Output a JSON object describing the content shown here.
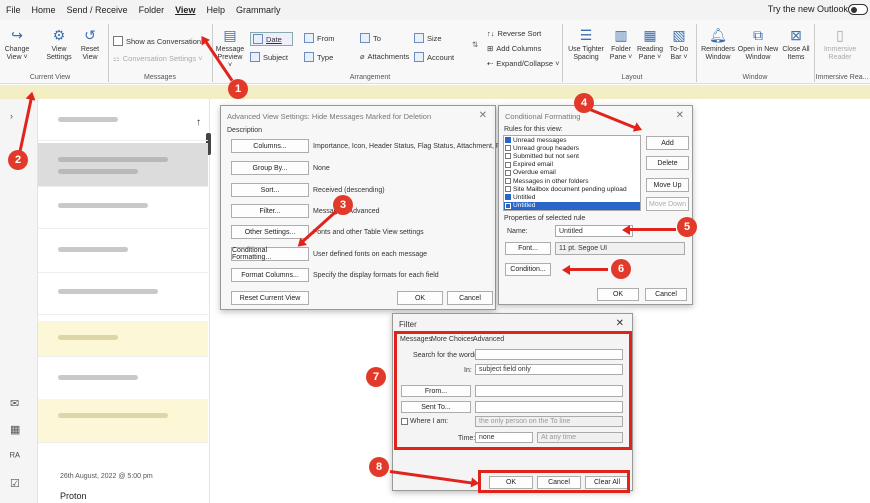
{
  "menu": {
    "items": [
      "File",
      "Home",
      "Send / Receive",
      "Folder",
      "View",
      "Help",
      "Grammarly"
    ],
    "active_index": 4,
    "try_new": "Try the new Outlook"
  },
  "ribbon": {
    "change_view": "Change View ˅",
    "view_settings": "View Settings",
    "reset_view": "Reset View",
    "show_as_conversations": "Show as Conversations",
    "conversation_settings": "Conversation Settings ˅",
    "message_preview": "Message Preview ˅",
    "date": "Date",
    "from": "From",
    "to": "To",
    "size": "Size",
    "subject": "Subject",
    "type": "Type",
    "attachments": "Attachments",
    "account": "Account",
    "reverse_sort": "Reverse Sort",
    "add_columns": "Add Columns",
    "expand_collapse": "Expand/Collapse ˅",
    "use_tighter_spacing": "Use Tighter Spacing",
    "folder_pane": "Folder Pane ˅",
    "reading_pane": "Reading Pane ˅",
    "todo_bar": "To-Do Bar ˅",
    "reminders_window": "Reminders Window",
    "open_new_window": "Open in New Window",
    "close_all_items": "Close All Items",
    "immersive_reader": "Immersive Reader",
    "groups": {
      "current_view": "Current View",
      "messages": "Messages",
      "arrangement": "Arrangement",
      "layout": "Layout",
      "window": "Window",
      "immersive": "Immersive Rea..."
    }
  },
  "message_list": {
    "date_label": "26th August, 2022 @ 5:00 pm",
    "sender": "Proton"
  },
  "advanced_view": {
    "title": "Advanced View Settings: Hide Messages Marked for Deletion",
    "description": "Description",
    "rows": [
      {
        "button": "Columns...",
        "value": "Importance, Icon, Header Status, Flag Status, Attachment, From, ..."
      },
      {
        "button": "Group By...",
        "value": "None"
      },
      {
        "button": "Sort...",
        "value": "Received (descending)"
      },
      {
        "button": "Filter...",
        "value": "Messages: Advanced"
      },
      {
        "button": "Other Settings...",
        "value": "Fonts and other Table View settings"
      },
      {
        "button": "Conditional Formatting...",
        "value": "User defined fonts on each message"
      },
      {
        "button": "Format Columns...",
        "value": "Specify the display formats for each field"
      }
    ],
    "reset": "Reset Current View",
    "ok": "OK",
    "cancel": "Cancel"
  },
  "conditional": {
    "title": "Conditional Formatting",
    "rules_label": "Rules for this view:",
    "rules": [
      {
        "label": "Unread messages",
        "checked": true
      },
      {
        "label": "Unread group headers",
        "checked": false
      },
      {
        "label": "Submitted but not sent",
        "checked": false
      },
      {
        "label": "Expired email",
        "checked": false
      },
      {
        "label": "Overdue email",
        "checked": false
      },
      {
        "label": "Messages in other folders",
        "checked": false
      },
      {
        "label": "Site Mailbox document pending upload",
        "checked": false
      },
      {
        "label": "Untitled",
        "checked": true
      },
      {
        "label": "Untitled",
        "checked": true
      }
    ],
    "add": "Add",
    "delete": "Delete",
    "move_up": "Move Up",
    "move_down": "Move Down",
    "properties": "Properties of selected rule",
    "name_label": "Name:",
    "name_value": "Untitled",
    "font_btn": "Font...",
    "font_value": "11 pt. Segoe UI",
    "condition": "Condition...",
    "ok": "OK",
    "cancel": "Cancel"
  },
  "filter": {
    "title": "Filter",
    "tabs": [
      "Messages",
      "More Choices",
      "Advanced"
    ],
    "search_label": "Search for the word(s):",
    "search_value": "",
    "in_label": "In:",
    "in_value": "subject field only",
    "from_btn": "From...",
    "sent_to_btn": "Sent To...",
    "where_label": "Where I am:",
    "where_value": "the only person on the To line",
    "time_label": "Time:",
    "time_value": "none",
    "time_range": "At any time",
    "ok": "OK",
    "cancel": "Cancel",
    "clear_all": "Clear All"
  },
  "markers": [
    "1",
    "2",
    "3",
    "4",
    "5",
    "6",
    "7",
    "8"
  ],
  "colors": {
    "annotation": "#e0241b",
    "accent": "#2a66c9"
  }
}
